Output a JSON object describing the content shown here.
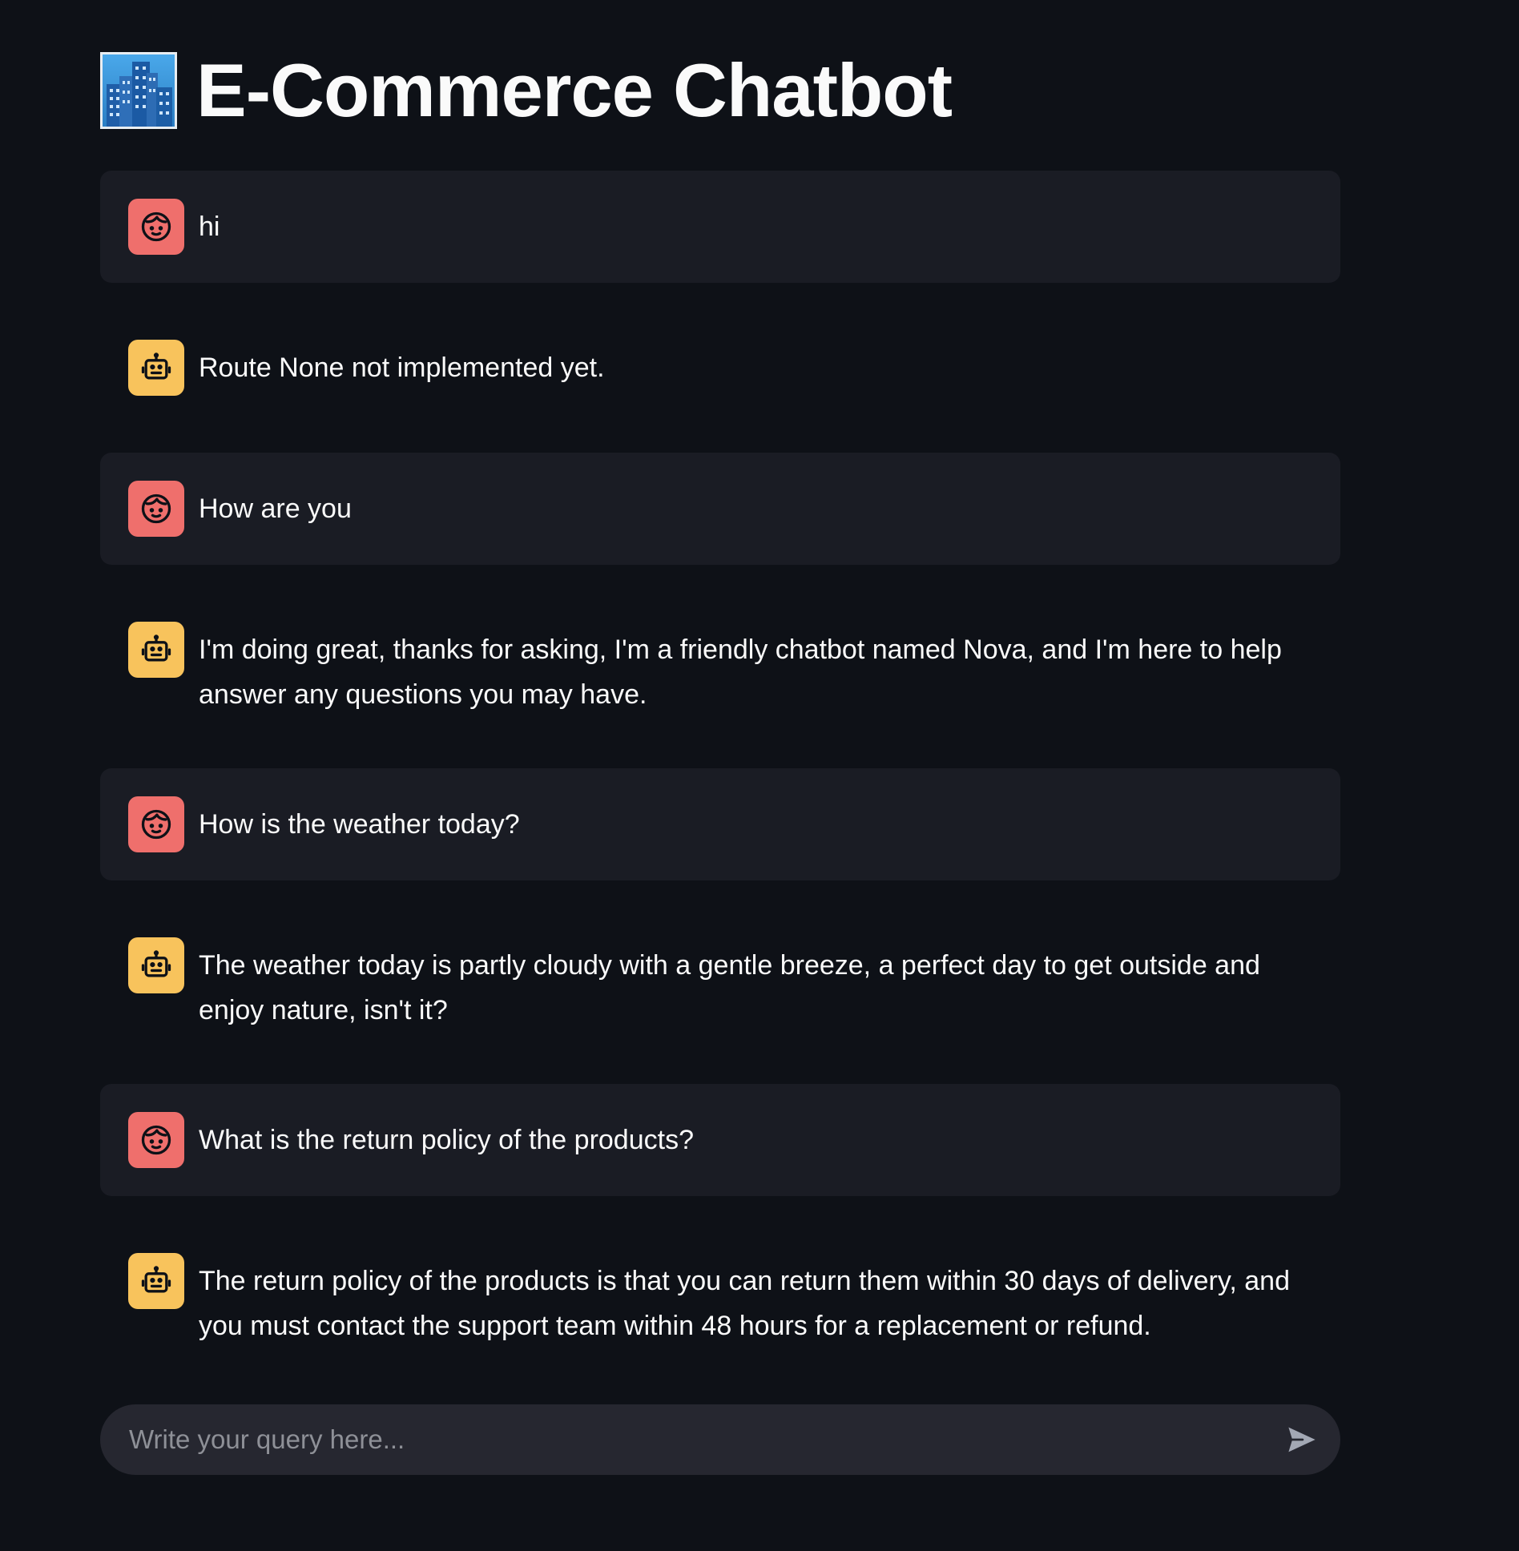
{
  "app": {
    "title": "E-Commerce Chatbot",
    "title_icon": "cityscape-icon"
  },
  "colors": {
    "background": "#0e1117",
    "user_bubble": "#1a1c24",
    "user_avatar": "#ef6f6c",
    "assistant_avatar": "#f8c35c",
    "input_background": "#262730"
  },
  "messages": [
    {
      "role": "user",
      "avatar_icon": "user-face-icon",
      "text": "hi"
    },
    {
      "role": "assistant",
      "avatar_icon": "robot-icon",
      "text": "Route None not implemented yet."
    },
    {
      "role": "user",
      "avatar_icon": "user-face-icon",
      "text": "How are you"
    },
    {
      "role": "assistant",
      "avatar_icon": "robot-icon",
      "text": "I'm doing great, thanks for asking, I'm a friendly chatbot named Nova, and I'm here to help answer any questions you may have."
    },
    {
      "role": "user",
      "avatar_icon": "user-face-icon",
      "text": "How is the weather today?"
    },
    {
      "role": "assistant",
      "avatar_icon": "robot-icon",
      "text": "The weather today is partly cloudy with a gentle breeze, a perfect day to get outside and enjoy nature, isn't it?"
    },
    {
      "role": "user",
      "avatar_icon": "user-face-icon",
      "text": "What is the return policy of the products?"
    },
    {
      "role": "assistant",
      "avatar_icon": "robot-icon",
      "text": "The return policy of the products is that you can return them within 30 days of delivery, and you must contact the support team within 48 hours for a replacement or refund."
    }
  ],
  "chat_input": {
    "placeholder": "Write your query here...",
    "value": "",
    "send_icon": "send-icon"
  }
}
